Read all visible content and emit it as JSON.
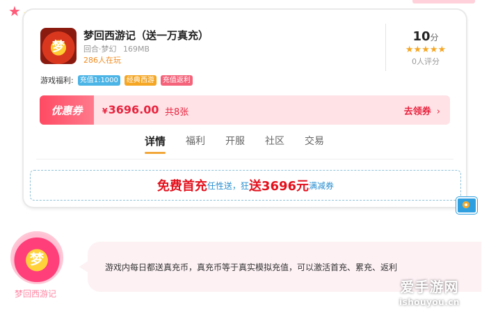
{
  "game": {
    "title": "梦回西游记（送一万真充）",
    "icon_text": "梦",
    "genre": "回合·梦幻",
    "size": "169MB",
    "players": "286人在玩",
    "score": "10",
    "score_unit": "分",
    "stars_value": 5,
    "stars_display": "★★★★★",
    "rating_count": "0人评分"
  },
  "welfare": {
    "label": "游戏福利:",
    "tags": [
      {
        "text": "充值1:1000",
        "color": "#4bb4e6"
      },
      {
        "text": "经典西游",
        "color": "#f5a623"
      },
      {
        "text": "充值返利",
        "color": "#f4637a"
      }
    ]
  },
  "coupon": {
    "badge": "优惠券",
    "currency": "¥",
    "amount": "3696.00",
    "count": "共8张",
    "action": "去领券",
    "chevron": "›"
  },
  "tabs": [
    {
      "label": "详情",
      "active": true
    },
    {
      "label": "福利",
      "active": false
    },
    {
      "label": "开服",
      "active": false
    },
    {
      "label": "社区",
      "active": false
    },
    {
      "label": "交易",
      "active": false
    }
  ],
  "promo": {
    "part1": "免费首充",
    "part2": "任性送，狂",
    "part3": "送3696元",
    "part4": "满减券"
  },
  "chat": {
    "avatar_text": "梦",
    "name": "梦回西游记",
    "message": "游戏内每日都送真充币，真充币等于真实模拟充值，可以激活首充、累充、返利"
  },
  "watermark": {
    "line1": "爱手游网",
    "line2": "ishouyou.cn"
  },
  "colors": {
    "accent_red": "#e8243f",
    "accent_orange": "#f2a73b",
    "promo_blue": "#2a8fd0",
    "bubble_bg": "#fdf1f4"
  }
}
